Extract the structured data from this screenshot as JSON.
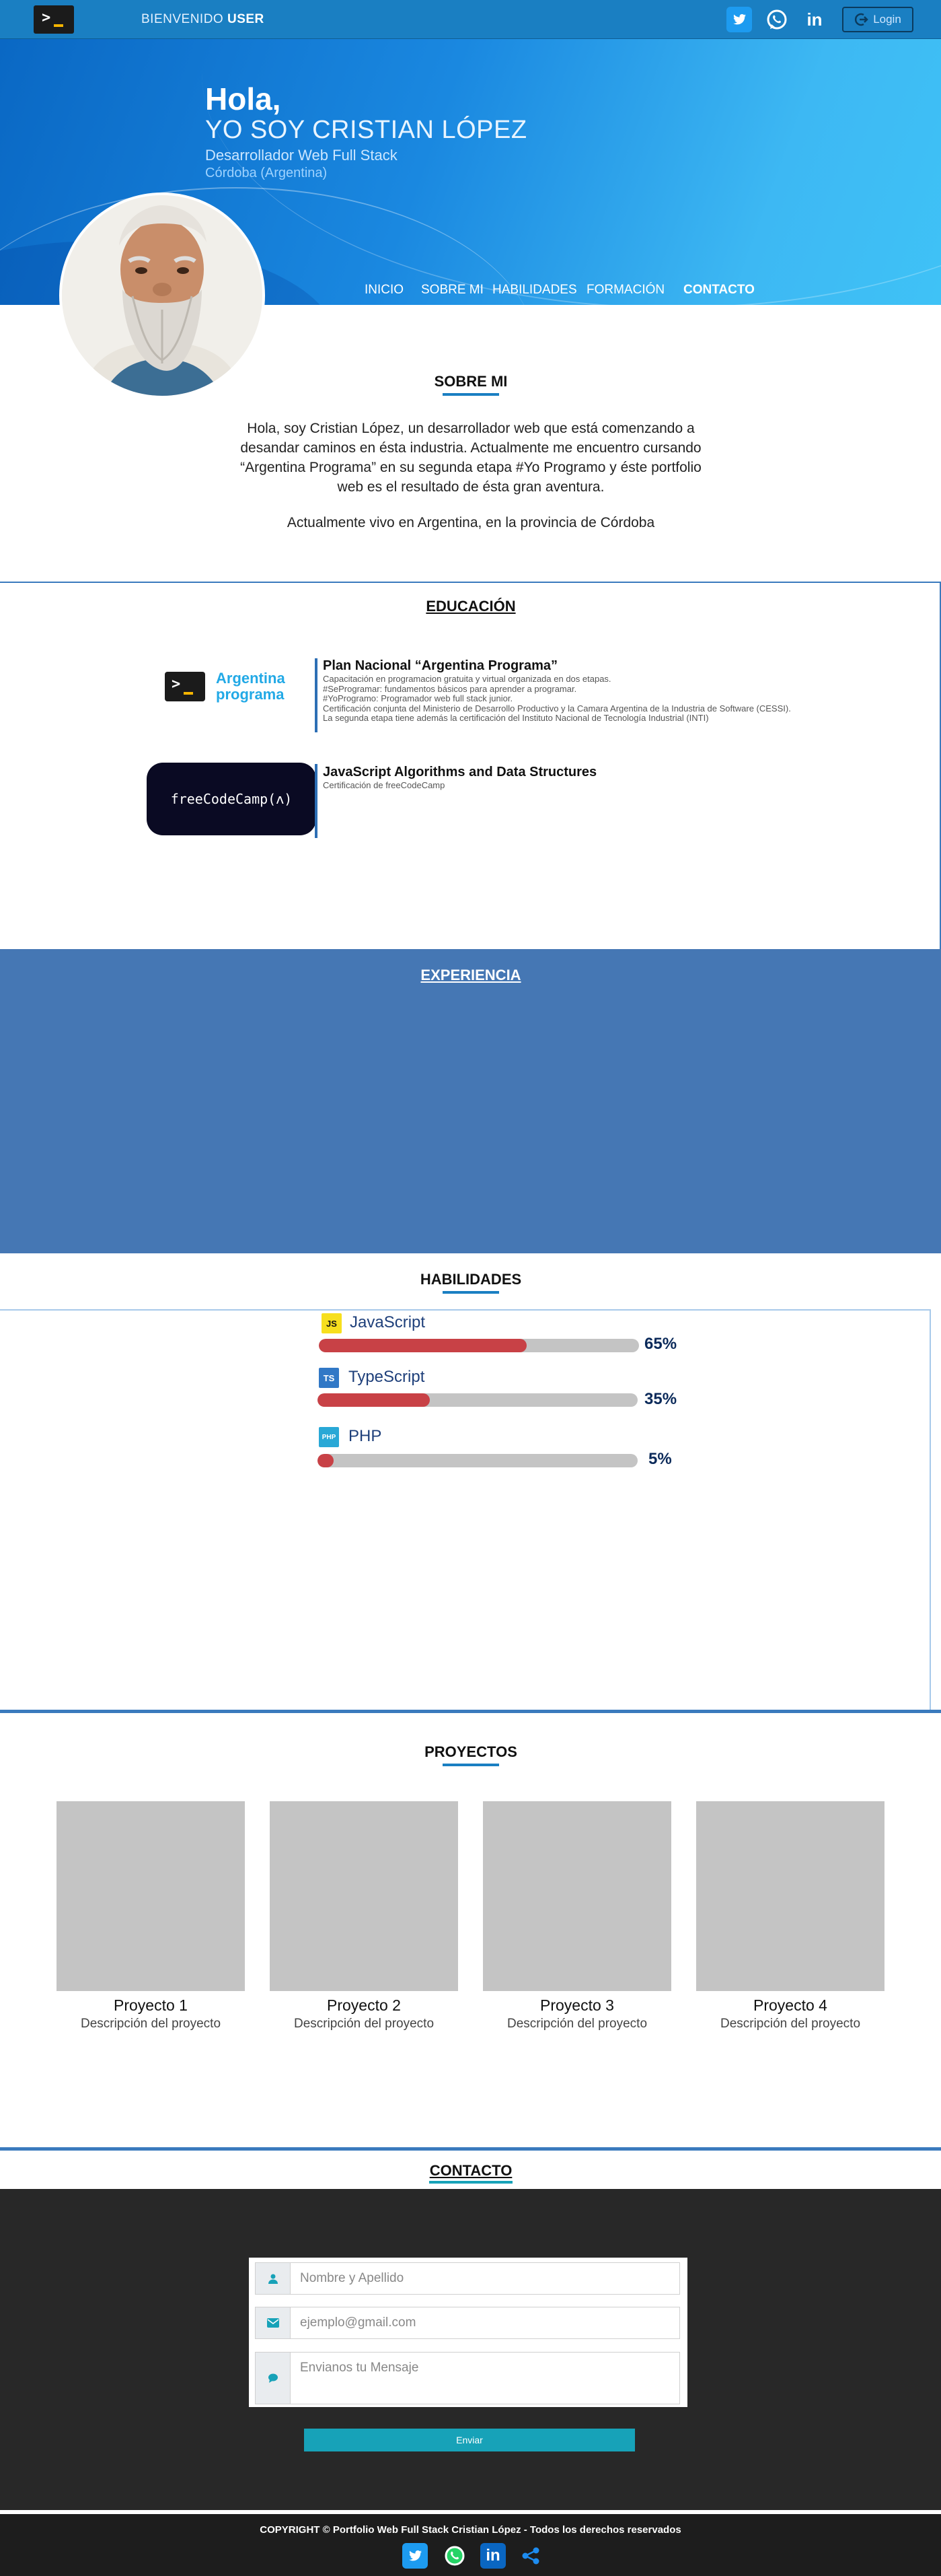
{
  "navbar": {
    "welcome": "BIENVENIDO",
    "user": "USER",
    "login_label": "Login",
    "icons": [
      "terminal-logo-icon",
      "twitter-icon",
      "whatsapp-icon",
      "linkedin-icon",
      "login-icon"
    ]
  },
  "hero": {
    "greeting": "Hola,",
    "name": "YO SOY CRISTIAN LÓPEZ",
    "role": "Desarrollador Web Full Stack",
    "location": "Córdoba (Argentina)"
  },
  "nav": {
    "inicio": "INICIO",
    "sobre_mi": "SOBRE MI",
    "habilidades": "HABILIDADES",
    "formacion": "FORMACIÓN",
    "contacto": "CONTACTO"
  },
  "about": {
    "title": "SOBRE MI",
    "p1": "Hola, soy Cristian López, un desarrollador web que está comenzando a desandar caminos en ésta industria. Actualmente me encuentro cursando “Argentina Programa” en su segunda etapa #Yo Programo y éste portfolio web es el resultado de ésta gran aventura.",
    "p2": "Actualmente vivo en Argentina, en la provincia de Córdoba"
  },
  "education": {
    "title": "EDUCACIÓN",
    "items": [
      {
        "logo_text": "Argentina programa",
        "heading": "Plan Nacional “Argentina Programa”",
        "lines": [
          "Capacitación en programacion gratuita y virtual organizada en dos etapas.",
          "#SeProgramar:  fundamentos básicos para aprender a programar.",
          "#YoProgramo: Programador web full stack junior.",
          "Certificación conjunta del Ministerio de Desarrollo Productivo y la Camara Argentina de la Industria de Software (CESSI).",
          "La segunda etapa tiene además la certificación del Instituto Nacional de Tecnología Industrial (INTI)"
        ]
      },
      {
        "logo_text": "freeCodeCamp(ʌ)",
        "heading": "JavaScript Algorithms and Data Structures",
        "lines": [
          "Certificación de freeCodeCamp"
        ]
      }
    ]
  },
  "experience": {
    "title": "EXPERIENCIA"
  },
  "skills": {
    "title": "HABILIDADES",
    "items": [
      {
        "name": "JavaScript",
        "badge": "JS",
        "percent_label": "65%",
        "level": 0.65,
        "icon_bg": "#f7df1e",
        "icon_fg": "#111111"
      },
      {
        "name": "TypeScript",
        "badge": "TS",
        "percent_label": "35%",
        "level": 0.35,
        "icon_bg": "#3178c6",
        "icon_fg": "#ffffff"
      },
      {
        "name": "PHP",
        "badge": "PHP",
        "percent_label": "5%",
        "level": 0.05,
        "icon_bg": "#29a8d6",
        "icon_fg": "#ffffff"
      }
    ]
  },
  "projects": {
    "title": "PROYECTOS",
    "items": [
      {
        "name": "Proyecto 1",
        "desc": "Descripción del proyecto"
      },
      {
        "name": "Proyecto 2",
        "desc": "Descripción del proyecto"
      },
      {
        "name": "Proyecto 3",
        "desc": "Descripción del proyecto"
      },
      {
        "name": "Proyecto 4",
        "desc": "Descripción del proyecto"
      }
    ]
  },
  "contact": {
    "title": "CONTACTO",
    "name_placeholder": "Nombre y Apellido",
    "email_placeholder": "ejemplo@gmail.com",
    "message_placeholder": "Envianos tu Mensaje",
    "send_label": "Enviar"
  },
  "footer": {
    "copyright": "COPYRIGHT © Portfolio Web Full Stack Cristian López - Todos los derechos reservados",
    "icons": [
      "twitter-icon",
      "whatsapp-icon",
      "linkedin-icon",
      "share-icon"
    ]
  },
  "colors": {
    "primary": "#1a7fc2",
    "experience_bg": "#4577b4",
    "skill_fill": "#c84146",
    "contact_bg": "#282828",
    "send_button": "#17a2b8"
  }
}
